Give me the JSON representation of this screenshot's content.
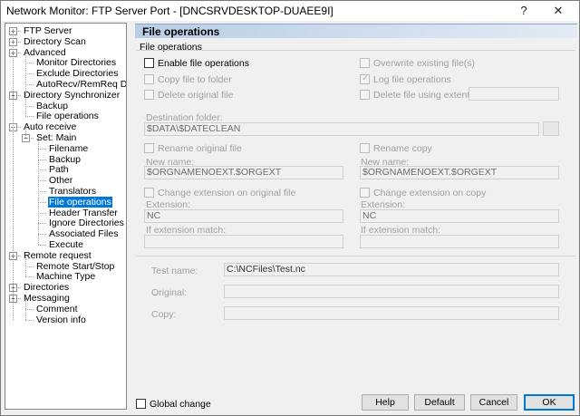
{
  "window": {
    "title": "Network Monitor: FTP Server Port - [DNCSRVDESKTOP-DUAEE9I]",
    "help_glyph": "?",
    "close_glyph": "✕"
  },
  "tree": [
    {
      "label": "FTP Server",
      "expander": "+"
    },
    {
      "label": "Directory Scan",
      "expander": "+"
    },
    {
      "label": "Advanced",
      "expander": "+"
    },
    {
      "label": "Monitor Directories",
      "expander": ""
    },
    {
      "label": "Exclude Directories",
      "expander": ""
    },
    {
      "label": "AutoRecv/RemReq Dirs.",
      "expander": ""
    },
    {
      "label": "Directory Synchronizer",
      "expander": "+"
    },
    {
      "label": "Backup",
      "expander": ""
    },
    {
      "label": "File operations",
      "expander": ""
    },
    {
      "label": "Auto receive",
      "expander": "−"
    },
    {
      "label": "Set: Main",
      "expander": "−"
    },
    {
      "label": "Filename",
      "expander": ""
    },
    {
      "label": "Backup",
      "expander": ""
    },
    {
      "label": "Path",
      "expander": ""
    },
    {
      "label": "Other",
      "expander": ""
    },
    {
      "label": "Translators",
      "expander": ""
    },
    {
      "label": "File operations",
      "expander": "",
      "selected": true
    },
    {
      "label": "Header Transfer",
      "expander": ""
    },
    {
      "label": "Ignore Directories",
      "expander": ""
    },
    {
      "label": "Associated Files",
      "expander": ""
    },
    {
      "label": "Execute",
      "expander": ""
    },
    {
      "label": "Remote request",
      "expander": "+"
    },
    {
      "label": "Remote Start/Stop",
      "expander": ""
    },
    {
      "label": "Machine Type",
      "expander": ""
    },
    {
      "label": "Directories",
      "expander": "+"
    },
    {
      "label": "Messaging",
      "expander": "+"
    },
    {
      "label": "Comment",
      "expander": ""
    },
    {
      "label": "Version info",
      "expander": ""
    }
  ],
  "panel": {
    "title": "File operations",
    "group_title": "File operations",
    "enable_file_operations": "Enable file operations",
    "overwrite_existing": "Overwrite existing file(s)",
    "copy_file_to_folder": "Copy file to folder",
    "log_file_operations": "Log file operations",
    "delete_original_file": "Delete original file",
    "delete_file_using_extension": "Delete file using extention:",
    "destination_folder_label": "Destination folder:",
    "destination_folder_value": "$DATA\\$DATECLEAN",
    "rename_original_file": "Rename original file",
    "rename_copy": "Rename copy",
    "new_name_label_left": "New name:",
    "new_name_value_left": "$ORGNAMENOEXT.$ORGEXT",
    "new_name_label_right": "New name:",
    "new_name_value_right": "$ORGNAMENOEXT.$ORGEXT",
    "change_ext_original": "Change extension on original file",
    "change_ext_copy": "Change extension on copy",
    "extension_label_left": "Extension:",
    "extension_value_left": "NC",
    "extension_label_right": "Extension:",
    "extension_value_right": "NC",
    "if_ext_match_left": "If extension match:",
    "if_ext_match_right": "If extension match:",
    "test_name_label": "Test name:",
    "test_name_value": "C:\\NCFiles\\Test.nc",
    "original_label": "Original:",
    "copy_label": "Copy:"
  },
  "footer": {
    "global_change": "Global change",
    "help": "Help",
    "default": "Default",
    "cancel": "Cancel",
    "ok": "OK"
  }
}
